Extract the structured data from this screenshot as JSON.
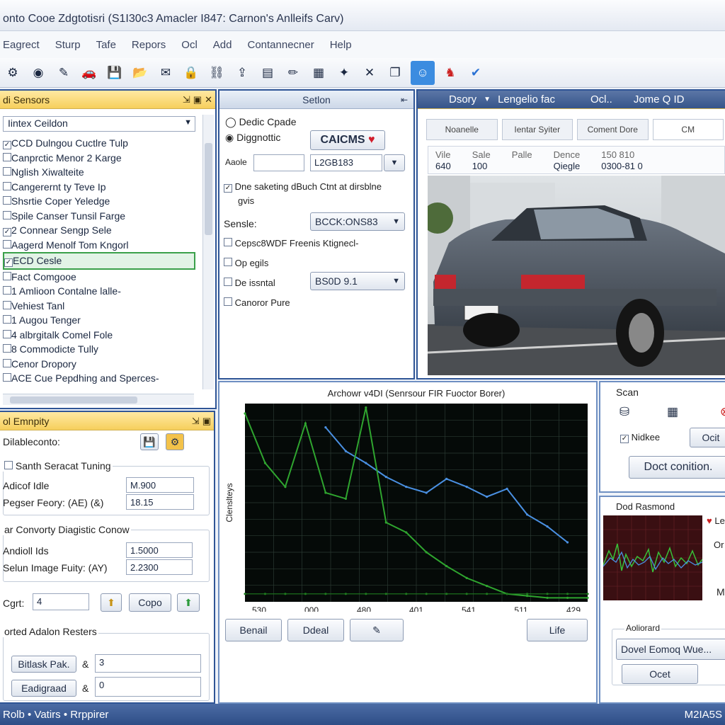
{
  "window": {
    "title": "onto Cooe Zdgtotisri (S1I30c3 Amacler I847: Carnon's Anlleifs Carv)"
  },
  "menu": [
    "Eagrect",
    "Sturp",
    "Tafe",
    "Repors",
    "Ocl",
    "Add",
    "Contannecner",
    "Help"
  ],
  "toolbar": [
    "gear-icon",
    "globe-icon",
    "pen-icon",
    "car-icon",
    "save-icon",
    "folder-icon",
    "mail-icon",
    "lock-icon",
    "network-icon",
    "export-icon",
    "chart-icon",
    "pencil-icon",
    "report-icon",
    "star-icon",
    "close-icon",
    "copy-icon",
    "user-icon",
    "robot-icon",
    "check-icon"
  ],
  "sensors": {
    "title": "di Sensors",
    "combo": "Iintex Ceildon",
    "items": [
      {
        "label": "CCD Dulngou Cuctlre Tulp",
        "checked": true
      },
      {
        "label": "Canprctic Menor 2 Karge",
        "checked": false
      },
      {
        "label": "Nglish Xiwalteite",
        "checked": false
      },
      {
        "label": "Cangerernt ty Teve Ip",
        "checked": false
      },
      {
        "label": "Shsrtie Coper Yeledge",
        "checked": false
      },
      {
        "label": "Spile Canser Tunsil Farge",
        "checked": false
      },
      {
        "label": "2 Connear Sengp Sele",
        "checked": true
      },
      {
        "label": "Aagerd Menolf Tom Kngorl",
        "checked": false
      },
      {
        "label": "ECD Cesle",
        "checked": true
      },
      {
        "label": "Fact Comgooe",
        "checked": false
      },
      {
        "label": "1 Amlioon Contalne lalle-",
        "checked": false
      },
      {
        "label": "Vehiest Tanl",
        "checked": false
      },
      {
        "label": "1 Augou Tenger",
        "checked": false
      },
      {
        "label": "4 albrgitalk Comel Fole",
        "checked": false
      },
      {
        "label": "8 Commodicte Tully",
        "checked": false
      },
      {
        "label": "Cenor Dropory",
        "checked": false
      },
      {
        "label": "ACE Cue Pepdhing and Sperces-",
        "checked": false
      }
    ]
  },
  "properties": {
    "title": "ol Emnpity",
    "subtitle": "Dilableconto:",
    "section1": "Santh Seracat Tuning",
    "s1_rows": [
      {
        "label": "Adicof Idle",
        "value": "M.900"
      },
      {
        "label": "Pegser Feory: (AE) (&)",
        "value": "18.15"
      }
    ],
    "section2": "ar Convorty Diagistic Conow",
    "s2_rows": [
      {
        "label": "Andioll Ids",
        "value": "1.5000"
      },
      {
        "label": "Selun Image Fuity: (AY)",
        "value": "2.2300"
      }
    ],
    "cgrt_label": "Cgrt:",
    "cgrt_value": "4",
    "copy_btn": "Copo",
    "section3": "orted Adalon Resters",
    "btn1": "Bitlask Pak.",
    "val1": "3",
    "btn2": "Eadigraad",
    "val2": "0"
  },
  "setup": {
    "title": "Setlon",
    "opt1": "Dedic Cpade",
    "opt2": "Diggnottic",
    "badge": "CAICMS",
    "small_label": "Aaole",
    "combo1": "L2GB183",
    "check_text1": "Dne saketing dBuch Ctnt at dirsblne",
    "check_text2": "gvis",
    "sensor_label": "Sensle:",
    "combo2": "BCCK:ONS83",
    "check3": "Cepsc8WDF Freenis Ktignecl-",
    "check4": "Op egils",
    "check5": "De issntal",
    "combo3": "BS0D 9.1",
    "check6": "Canoror Pure"
  },
  "viewer": {
    "header_left": "Dsory",
    "header_mid": "Lengelio fac",
    "header_right1": "Ocl..",
    "header_right2": "Jome Q ID",
    "tabs": [
      "Noanelle",
      "Ientar Syiter",
      "Coment Dore",
      "CM"
    ],
    "info": [
      {
        "k": "Vile",
        "v": "640"
      },
      {
        "k": "Sale",
        "v": "100"
      },
      {
        "k": "Palle",
        "v": ""
      },
      {
        "k": "Dence",
        "v": "Qiegle"
      },
      {
        "k": "150 810",
        "v": "0300-81 0"
      }
    ]
  },
  "chart_panel": {
    "buttons": [
      "Benail",
      "Ddeal",
      "",
      "Life"
    ]
  },
  "chart_data": {
    "type": "line",
    "title": "Archowr v4DI (Senrsour FIR Fuoctor Borer)",
    "ylabel": "Clenslteys",
    "xlabel": "",
    "x": [
      510,
      540,
      570,
      600,
      630,
      660,
      690,
      720,
      750,
      780,
      810,
      840,
      870,
      900,
      930,
      960,
      990,
      1020
    ],
    "xticks": [
      "530",
      "000",
      "480",
      "401",
      "541",
      "511",
      "429"
    ],
    "ylim": [
      0,
      100
    ],
    "grid": true,
    "series": [
      {
        "color": "#4a90e2",
        "values": [
          null,
          null,
          null,
          null,
          88,
          76,
          70,
          63,
          58,
          55,
          62,
          58,
          53,
          57,
          44,
          38,
          30,
          null
        ]
      },
      {
        "color": "#2fa52f",
        "values": [
          95,
          70,
          58,
          90,
          55,
          52,
          98,
          40,
          35,
          25,
          18,
          12,
          8,
          4,
          3,
          2,
          2,
          2
        ]
      },
      {
        "color": "#1f7a1f",
        "values": [
          4,
          4,
          4,
          4,
          4,
          4,
          4,
          4,
          4,
          4,
          4,
          4,
          4,
          4,
          4,
          4,
          4,
          4
        ]
      }
    ]
  },
  "scan": {
    "title": "Scan",
    "check": "Nidkee",
    "btn_small": "Ocit",
    "btn_main": "Doct conition."
  },
  "realtime": {
    "title": "Dod Rasmond",
    "label1": "Le",
    "label2": "Or",
    "label3": "M",
    "section": "Aoliorard",
    "btn1": "Dovel Eomoq Wue...",
    "btn2": "Ocet"
  },
  "status": {
    "left": "Rolb  •  Vatirs  •  Rrppirer",
    "right": "M2IA5S"
  }
}
